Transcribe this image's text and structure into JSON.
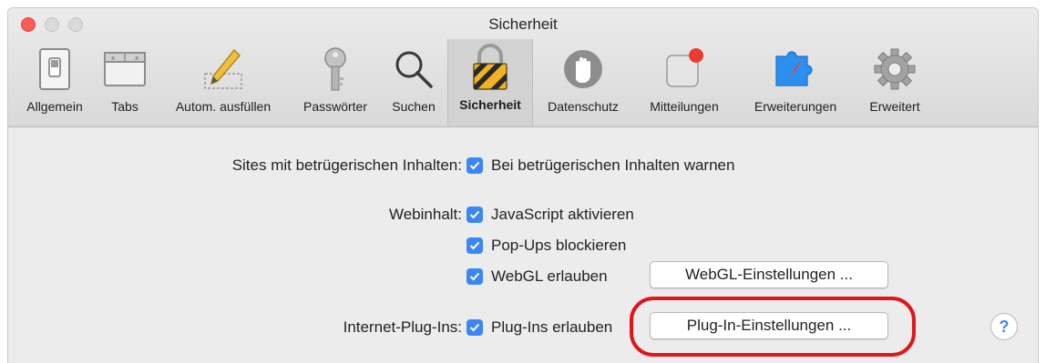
{
  "window": {
    "title": "Sicherheit"
  },
  "toolbar": {
    "items": [
      {
        "label": "Allgemein",
        "icon": "general-switch-icon"
      },
      {
        "label": "Tabs",
        "icon": "tabs-icon"
      },
      {
        "label": "Autom. ausfüllen",
        "icon": "pencil-icon"
      },
      {
        "label": "Passwörter",
        "icon": "key-icon"
      },
      {
        "label": "Suchen",
        "icon": "magnifier-icon"
      },
      {
        "label": "Sicherheit",
        "icon": "padlock-icon",
        "selected": true
      },
      {
        "label": "Datenschutz",
        "icon": "hand-icon"
      },
      {
        "label": "Mitteilungen",
        "icon": "notification-badge-icon"
      },
      {
        "label": "Erweiterungen",
        "icon": "puzzle-compass-icon"
      },
      {
        "label": "Erweitert",
        "icon": "gear-icon"
      }
    ]
  },
  "fraud": {
    "label": "Sites mit betrügerischen Inhalten:",
    "checkbox": {
      "label": "Bei betrügerischen Inhalten warnen",
      "checked": true
    }
  },
  "webcontent": {
    "label": "Webinhalt:",
    "javascript": {
      "label": "JavaScript aktivieren",
      "checked": true
    },
    "popups": {
      "label": "Pop-Ups blockieren",
      "checked": true
    },
    "webgl": {
      "label": "WebGL erlauben",
      "checked": true
    },
    "webgl_button": "WebGL-Einstellungen ..."
  },
  "plugins": {
    "label": "Internet-Plug-Ins:",
    "checkbox": {
      "label": "Plug-Ins erlauben",
      "checked": true
    },
    "button": "Plug-In-Einstellungen ..."
  },
  "help": {
    "label": "?"
  },
  "colors": {
    "accent": "#3c87f5",
    "annotation": "#e2141c",
    "close": "#fc5c56"
  }
}
